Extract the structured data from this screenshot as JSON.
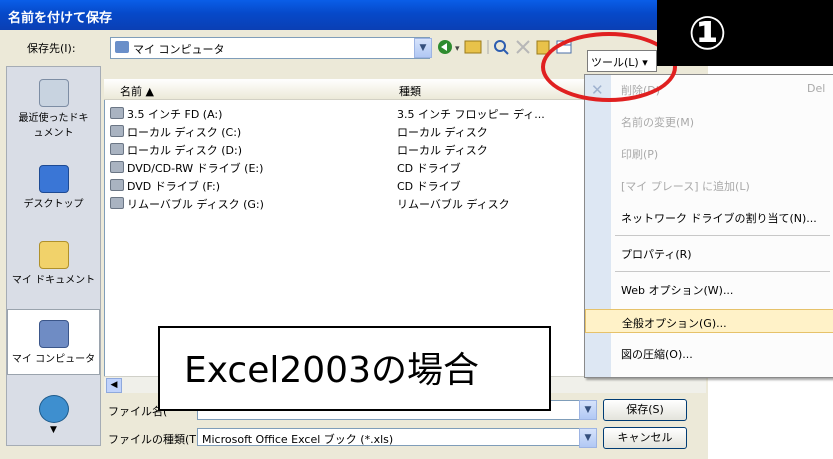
{
  "dialog": {
    "title": "名前を付けて保存"
  },
  "lookin": {
    "label": "保存先(I):",
    "value": "マイ コンピュータ"
  },
  "toolbar": {
    "tools_label": "ツール(L) ▾"
  },
  "places": [
    {
      "label": "最近使ったドキュメント",
      "icon": "recent-documents-icon"
    },
    {
      "label": "デスクトップ",
      "icon": "desktop-icon"
    },
    {
      "label": "マイ ドキュメント",
      "icon": "my-documents-icon"
    },
    {
      "label": "マイ コンピュータ",
      "icon": "my-computer-icon"
    },
    {
      "label": "",
      "icon": "network-places-icon"
    }
  ],
  "columns": {
    "name": "名前 ▲",
    "type": "種類"
  },
  "files": [
    {
      "name": "3.5 インチ FD (A:)",
      "type": "3.5 インチ フロッピー ディ..."
    },
    {
      "name": "ローカル ディスク (C:)",
      "type": "ローカル ディスク"
    },
    {
      "name": "ローカル ディスク (D:)",
      "type": "ローカル ディスク"
    },
    {
      "name": "DVD/CD-RW ドライブ (E:)",
      "type": "CD ドライブ"
    },
    {
      "name": "DVD ドライブ (F:)",
      "type": "CD ドライブ"
    },
    {
      "name": "リムーバブル ディスク (G:)",
      "type": "リムーバブル ディスク"
    }
  ],
  "filename": {
    "label": "ファイル名(",
    "value": ""
  },
  "filetype": {
    "label": "ファイルの種類(T):",
    "value": "Microsoft Office Excel ブック (*.xls)"
  },
  "buttons": {
    "save": "保存(S)",
    "cancel": "キャンセル"
  },
  "menu": [
    {
      "label": "削除(D)",
      "key": "Del",
      "disabled": true
    },
    {
      "label": "名前の変更(M)",
      "key": "",
      "disabled": true
    },
    {
      "label": "印刷(P)",
      "key": "",
      "disabled": true
    },
    {
      "label": "[マイ プレース] に追加(L)",
      "key": "",
      "disabled": true
    },
    {
      "label": "ネットワーク ドライブの割り当て(N)...",
      "key": "",
      "disabled": false
    },
    {
      "label": "プロパティ(R)",
      "key": "",
      "disabled": false
    },
    {
      "label": "Web オプション(W)...",
      "key": "",
      "disabled": false
    },
    {
      "label": "全般オプション(G)...",
      "key": "",
      "disabled": false,
      "highlighted": true
    },
    {
      "label": "図の圧縮(O)...",
      "key": "",
      "disabled": false
    }
  ],
  "annotation": {
    "step": "①",
    "caption": "Excel2003の場合"
  },
  "colors": {
    "highlight_ring": "#e02020",
    "menu_highlight": "#fff2c8"
  }
}
